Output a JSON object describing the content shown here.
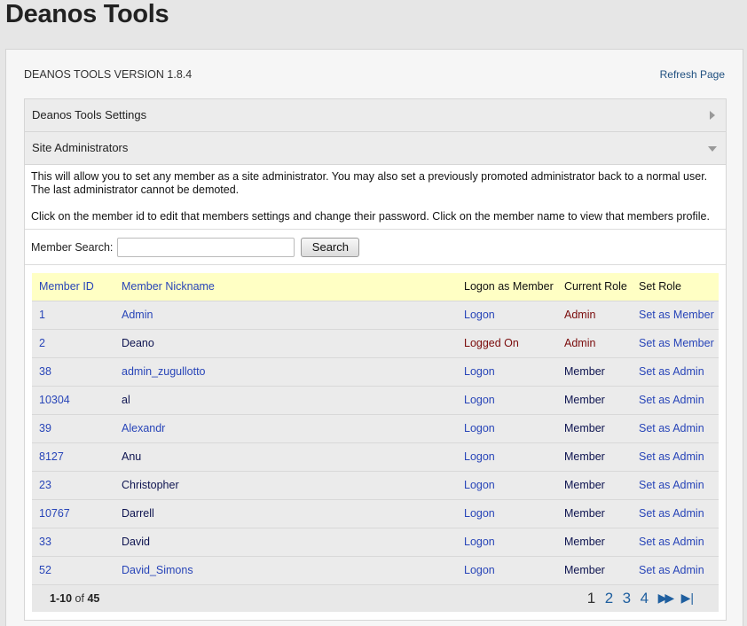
{
  "app_title": "Deanos Tools",
  "version_label": "DEANOS TOOLS VERSION 1.8.4",
  "refresh_link": "Refresh Page",
  "accordion": {
    "settings_label": "Deanos Tools Settings",
    "admins_label": "Site Administrators"
  },
  "description": {
    "para1": "This will allow you to set any member as a site administrator. You may also set a previously promoted administrator back to a normal user. The last administrator cannot be demoted.",
    "para2": "Click on the member id to edit that members settings and change their password. Click on the member name to view that members profile."
  },
  "search": {
    "label": "Member Search:",
    "value": "",
    "placeholder": "",
    "button": "Search"
  },
  "table": {
    "headers": {
      "id": "Member ID",
      "nick": "Member Nickname",
      "logon": "Logon as Member",
      "role": "Current Role",
      "set": "Set Role"
    },
    "rows": [
      {
        "id": "1",
        "nick": "Admin",
        "logon": "Logon",
        "role": "Admin",
        "set": "Set as Member"
      },
      {
        "id": "2",
        "nick": "Deano",
        "logon": "Logged On",
        "role": "Admin",
        "set": "Set as Member"
      },
      {
        "id": "38",
        "nick": "admin_zugullotto",
        "logon": "Logon",
        "role": "Member",
        "set": "Set as Admin"
      },
      {
        "id": "10304",
        "nick": "al",
        "logon": "Logon",
        "role": "Member",
        "set": "Set as Admin"
      },
      {
        "id": "39",
        "nick": "Alexandr",
        "logon": "Logon",
        "role": "Member",
        "set": "Set as Admin"
      },
      {
        "id": "8127",
        "nick": "Anu",
        "logon": "Logon",
        "role": "Member",
        "set": "Set as Admin"
      },
      {
        "id": "23",
        "nick": "Christopher",
        "logon": "Logon",
        "role": "Member",
        "set": "Set as Admin"
      },
      {
        "id": "10767",
        "nick": "Darrell",
        "logon": "Logon",
        "role": "Member",
        "set": "Set as Admin"
      },
      {
        "id": "33",
        "nick": "David",
        "logon": "Logon",
        "role": "Member",
        "set": "Set as Admin"
      },
      {
        "id": "52",
        "nick": "David_Simons",
        "logon": "Logon",
        "role": "Member",
        "set": "Set as Admin"
      }
    ]
  },
  "pagination": {
    "range": "1-10",
    "of_word": "of",
    "total": "45",
    "pages": [
      "1",
      "2",
      "3",
      "4"
    ],
    "current": "1",
    "next_icon": "fast-forward-icon",
    "last_icon": "skip-to-end-icon"
  },
  "colors": {
    "link": "#2845b8",
    "header_bg": "#ffffc4",
    "admin_red": "#7a0b0b"
  }
}
